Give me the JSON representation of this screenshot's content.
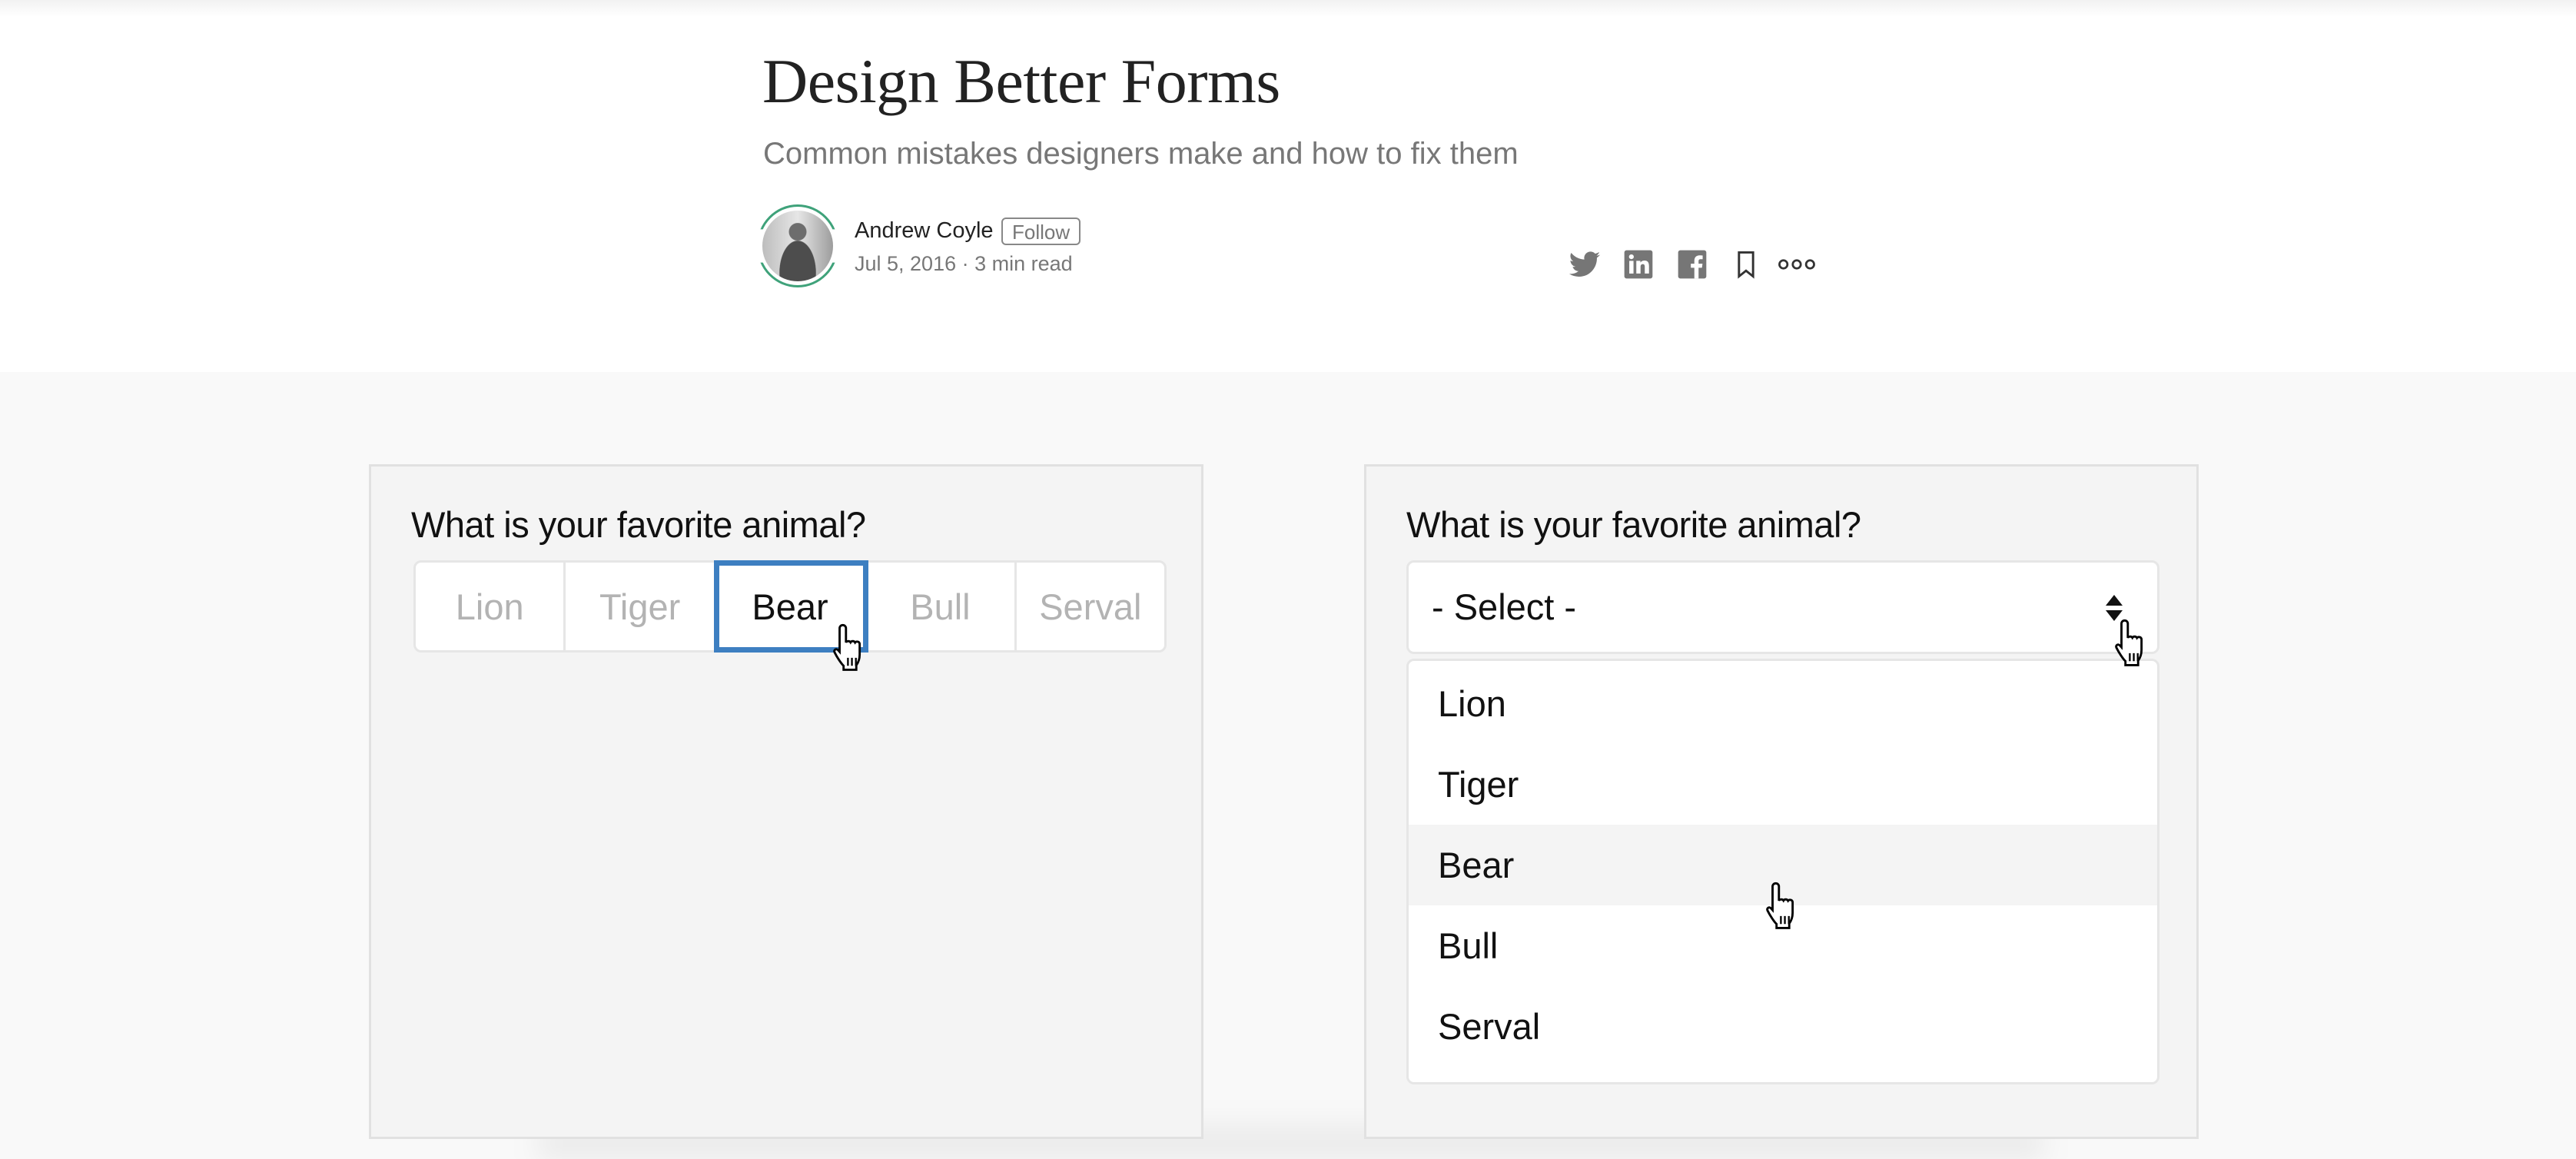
{
  "article": {
    "title": "Design Better Forms",
    "subtitle": "Common mistakes designers make and how to fix them",
    "author": {
      "name": "Andrew Coyle",
      "follow_label": "Follow",
      "meta": "Jul 5, 2016 · 3 min read"
    },
    "share_icons": [
      "twitter-icon",
      "linkedin-icon",
      "facebook-icon",
      "bookmark-icon",
      "more-icon"
    ]
  },
  "colors": {
    "accent_blue": "#3d7fc1",
    "avatar_ring_green": "#3fa27a",
    "icon_gray": "#767676"
  },
  "examples": {
    "left": {
      "question": "What is your favorite animal?",
      "options": [
        "Lion",
        "Tiger",
        "Bear",
        "Bull",
        "Serval"
      ],
      "selected": "Bear"
    },
    "right": {
      "question": "What is your favorite animal?",
      "select_value": "- Select -",
      "options": [
        "Lion",
        "Tiger",
        "Bear",
        "Bull",
        "Serval"
      ],
      "hovered": "Bear"
    }
  }
}
